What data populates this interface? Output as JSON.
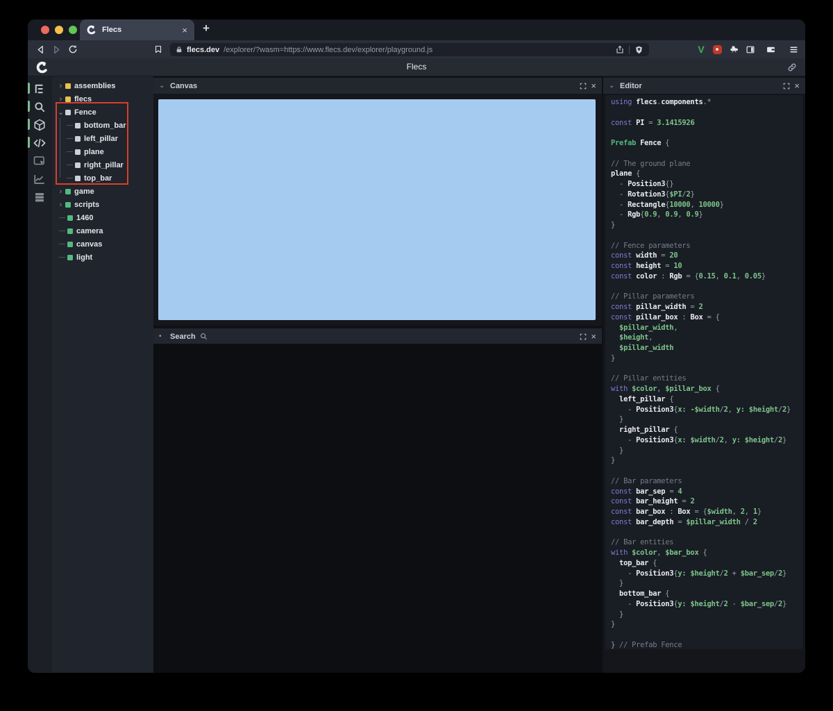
{
  "browser": {
    "tab_title": "Flecs",
    "tab_close_glyph": "×",
    "new_tab_glyph": "+",
    "url_domain": "flecs.dev",
    "url_path": "/explorer/?wasm=https://www.flecs.dev/explorer/playground.js",
    "extension_v_label": "V",
    "traffic_lights": [
      "#ed6a5e",
      "#f5bf4f",
      "#62c554"
    ]
  },
  "header": {
    "title": "Flecs"
  },
  "nav_rail": {
    "items": [
      {
        "icon": "tree-icon",
        "active": true
      },
      {
        "icon": "search-icon",
        "active": true
      },
      {
        "icon": "cube-icon",
        "active": true
      },
      {
        "icon": "code-icon",
        "active": true
      },
      {
        "icon": "inspector-icon",
        "active": false
      },
      {
        "icon": "chart-icon",
        "active": false
      },
      {
        "icon": "rows-icon",
        "active": false
      }
    ]
  },
  "tree": {
    "items": [
      {
        "label": "assemblies",
        "marker": "chevron-right",
        "square": "#e3c24f",
        "child": false
      },
      {
        "label": "flecs",
        "marker": "chevron-right",
        "square": "#e3c24f",
        "child": false
      },
      {
        "label": "Fence",
        "marker": "chevron-down",
        "square": "#ccd0d8",
        "child": false
      },
      {
        "label": "bottom_bar",
        "marker": "connector",
        "square": "#ccd0d8",
        "child": true
      },
      {
        "label": "left_pillar",
        "marker": "connector",
        "square": "#ccd0d8",
        "child": true
      },
      {
        "label": "plane",
        "marker": "connector",
        "square": "#ccd0d8",
        "child": true
      },
      {
        "label": "right_pillar",
        "marker": "connector",
        "square": "#ccd0d8",
        "child": true
      },
      {
        "label": "top_bar",
        "marker": "connector",
        "square": "#ccd0d8",
        "child": true
      },
      {
        "label": "game",
        "marker": "chevron-right",
        "square": "#53ba7f",
        "child": false
      },
      {
        "label": "scripts",
        "marker": "chevron-right",
        "square": "#53ba7f",
        "child": false
      },
      {
        "label": "1460",
        "marker": "dash",
        "square": "#53ba7f",
        "child": false
      },
      {
        "label": "camera",
        "marker": "dash",
        "square": "#53ba7f",
        "child": false
      },
      {
        "label": "canvas",
        "marker": "dash",
        "square": "#53ba7f",
        "child": false
      },
      {
        "label": "light",
        "marker": "dash",
        "square": "#53ba7f",
        "child": false
      }
    ],
    "highlight_color": "#d8402c",
    "chevron_right_glyph": "›",
    "chevron_down_glyph": "⌄"
  },
  "panels": {
    "canvas": {
      "title": "Canvas",
      "glyph": "⌄",
      "close_glyph": "×"
    },
    "search": {
      "title": "Search",
      "glyph": "•",
      "close_glyph": "×"
    },
    "editor": {
      "title": "Editor",
      "glyph": "⌄",
      "close_glyph": "×"
    }
  },
  "editor": {
    "lines": [
      [
        [
          "k",
          "using "
        ],
        [
          "i",
          "flecs"
        ],
        [
          "o",
          "."
        ],
        [
          "i",
          "components"
        ],
        [
          "o",
          ".*"
        ]
      ],
      [],
      [
        [
          "k",
          "const "
        ],
        [
          "i",
          "PI"
        ],
        [
          "o",
          " = "
        ],
        [
          "n",
          "3.1415926"
        ]
      ],
      [],
      [
        [
          "p",
          "Prefab "
        ],
        [
          "i",
          "Fence "
        ],
        [
          "o",
          "{"
        ]
      ],
      [],
      [
        [
          "c",
          "// The ground plane"
        ]
      ],
      [
        [
          "i",
          "plane "
        ],
        [
          "o",
          "{"
        ]
      ],
      [
        [
          "o",
          "  - "
        ],
        [
          "i",
          "Position3"
        ],
        [
          "o",
          "{}"
        ]
      ],
      [
        [
          "o",
          "  - "
        ],
        [
          "i",
          "Rotation3"
        ],
        [
          "o",
          "{"
        ],
        [
          "v",
          "$PI"
        ],
        [
          "o",
          "/"
        ],
        [
          "n",
          "2"
        ],
        [
          "o",
          "}"
        ]
      ],
      [
        [
          "o",
          "  - "
        ],
        [
          "i",
          "Rectangle"
        ],
        [
          "o",
          "{"
        ],
        [
          "n",
          "10000"
        ],
        [
          "o",
          ", "
        ],
        [
          "n",
          "10000"
        ],
        [
          "o",
          "}"
        ]
      ],
      [
        [
          "o",
          "  - "
        ],
        [
          "i",
          "Rgb"
        ],
        [
          "o",
          "{"
        ],
        [
          "n",
          "0.9"
        ],
        [
          "o",
          ", "
        ],
        [
          "n",
          "0.9"
        ],
        [
          "o",
          ", "
        ],
        [
          "n",
          "0.9"
        ],
        [
          "o",
          "}"
        ]
      ],
      [
        [
          "o",
          "}"
        ]
      ],
      [],
      [
        [
          "c",
          "// Fence parameters"
        ]
      ],
      [
        [
          "k",
          "const "
        ],
        [
          "i",
          "width"
        ],
        [
          "o",
          " = "
        ],
        [
          "n",
          "20"
        ]
      ],
      [
        [
          "k",
          "const "
        ],
        [
          "i",
          "height"
        ],
        [
          "o",
          " = "
        ],
        [
          "n",
          "10"
        ]
      ],
      [
        [
          "k",
          "const "
        ],
        [
          "i",
          "color"
        ],
        [
          "o",
          " : "
        ],
        [
          "i",
          "Rgb"
        ],
        [
          "o",
          " = {"
        ],
        [
          "n",
          "0.15"
        ],
        [
          "o",
          ", "
        ],
        [
          "n",
          "0.1"
        ],
        [
          "o",
          ", "
        ],
        [
          "n",
          "0.05"
        ],
        [
          "o",
          "}"
        ]
      ],
      [],
      [
        [
          "c",
          "// Pillar parameters"
        ]
      ],
      [
        [
          "k",
          "const "
        ],
        [
          "i",
          "pillar_width"
        ],
        [
          "o",
          " = "
        ],
        [
          "n",
          "2"
        ]
      ],
      [
        [
          "k",
          "const "
        ],
        [
          "i",
          "pillar_box"
        ],
        [
          "o",
          " : "
        ],
        [
          "i",
          "Box"
        ],
        [
          "o",
          " = {"
        ]
      ],
      [
        [
          "v",
          "  $pillar_width"
        ],
        [
          "o",
          ","
        ]
      ],
      [
        [
          "v",
          "  $height"
        ],
        [
          "o",
          ","
        ]
      ],
      [
        [
          "v",
          "  $pillar_width"
        ]
      ],
      [
        [
          "o",
          "}"
        ]
      ],
      [],
      [
        [
          "c",
          "// Pillar entities"
        ]
      ],
      [
        [
          "k",
          "with "
        ],
        [
          "v",
          "$color"
        ],
        [
          "o",
          ", "
        ],
        [
          "v",
          "$pillar_box"
        ],
        [
          "o",
          " {"
        ]
      ],
      [
        [
          "i",
          "  left_pillar "
        ],
        [
          "o",
          "{"
        ]
      ],
      [
        [
          "o",
          "    - "
        ],
        [
          "i",
          "Position3"
        ],
        [
          "o",
          "{"
        ],
        [
          "v",
          "x: -$width"
        ],
        [
          "o",
          "/"
        ],
        [
          "n",
          "2"
        ],
        [
          "o",
          ", "
        ],
        [
          "v",
          "y: $height"
        ],
        [
          "o",
          "/"
        ],
        [
          "n",
          "2"
        ],
        [
          "o",
          "}"
        ]
      ],
      [
        [
          "o",
          "  }"
        ]
      ],
      [
        [
          "i",
          "  right_pillar "
        ],
        [
          "o",
          "{"
        ]
      ],
      [
        [
          "o",
          "    - "
        ],
        [
          "i",
          "Position3"
        ],
        [
          "o",
          "{"
        ],
        [
          "v",
          "x: $width"
        ],
        [
          "o",
          "/"
        ],
        [
          "n",
          "2"
        ],
        [
          "o",
          ", "
        ],
        [
          "v",
          "y: $height"
        ],
        [
          "o",
          "/"
        ],
        [
          "n",
          "2"
        ],
        [
          "o",
          "}"
        ]
      ],
      [
        [
          "o",
          "  }"
        ]
      ],
      [
        [
          "o",
          "}"
        ]
      ],
      [],
      [
        [
          "c",
          "// Bar parameters"
        ]
      ],
      [
        [
          "k",
          "const "
        ],
        [
          "i",
          "bar_sep"
        ],
        [
          "o",
          " = "
        ],
        [
          "n",
          "4"
        ]
      ],
      [
        [
          "k",
          "const "
        ],
        [
          "i",
          "bar_height"
        ],
        [
          "o",
          " = "
        ],
        [
          "n",
          "2"
        ]
      ],
      [
        [
          "k",
          "const "
        ],
        [
          "i",
          "bar_box"
        ],
        [
          "o",
          " : "
        ],
        [
          "i",
          "Box"
        ],
        [
          "o",
          " = {"
        ],
        [
          "v",
          "$width"
        ],
        [
          "o",
          ", "
        ],
        [
          "n",
          "2"
        ],
        [
          "o",
          ", "
        ],
        [
          "n",
          "1"
        ],
        [
          "o",
          "}"
        ]
      ],
      [
        [
          "k",
          "const "
        ],
        [
          "i",
          "bar_depth"
        ],
        [
          "o",
          " = "
        ],
        [
          "v",
          "$pillar_width"
        ],
        [
          "o",
          " / "
        ],
        [
          "n",
          "2"
        ]
      ],
      [],
      [
        [
          "c",
          "// Bar entities"
        ]
      ],
      [
        [
          "k",
          "with "
        ],
        [
          "v",
          "$color"
        ],
        [
          "o",
          ", "
        ],
        [
          "v",
          "$bar_box"
        ],
        [
          "o",
          " {"
        ]
      ],
      [
        [
          "i",
          "  top_bar "
        ],
        [
          "o",
          "{"
        ]
      ],
      [
        [
          "o",
          "    - "
        ],
        [
          "i",
          "Position3"
        ],
        [
          "o",
          "{"
        ],
        [
          "v",
          "y: $height"
        ],
        [
          "o",
          "/"
        ],
        [
          "n",
          "2"
        ],
        [
          "o",
          " + "
        ],
        [
          "v",
          "$bar_sep"
        ],
        [
          "o",
          "/"
        ],
        [
          "n",
          "2"
        ],
        [
          "o",
          "}"
        ]
      ],
      [
        [
          "o",
          "  }"
        ]
      ],
      [
        [
          "i",
          "  bottom_bar "
        ],
        [
          "o",
          "{"
        ]
      ],
      [
        [
          "o",
          "    - "
        ],
        [
          "i",
          "Position3"
        ],
        [
          "o",
          "{"
        ],
        [
          "v",
          "y: $height"
        ],
        [
          "o",
          "/"
        ],
        [
          "n",
          "2"
        ],
        [
          "o",
          " - "
        ],
        [
          "v",
          "$bar_sep"
        ],
        [
          "o",
          "/"
        ],
        [
          "n",
          "2"
        ],
        [
          "o",
          "}"
        ]
      ],
      [
        [
          "o",
          "  }"
        ]
      ],
      [
        [
          "o",
          "}"
        ]
      ],
      [],
      [
        [
          "o",
          "} "
        ],
        [
          "c",
          "// Prefab Fence"
        ]
      ]
    ]
  },
  "colors": {
    "canvas_blue": "#a6cbf0",
    "accent_green": "#53ba7f",
    "accent_yellow": "#e3c24f",
    "keyword_purple": "#7f7ad0",
    "code_green": "#7cc489"
  }
}
